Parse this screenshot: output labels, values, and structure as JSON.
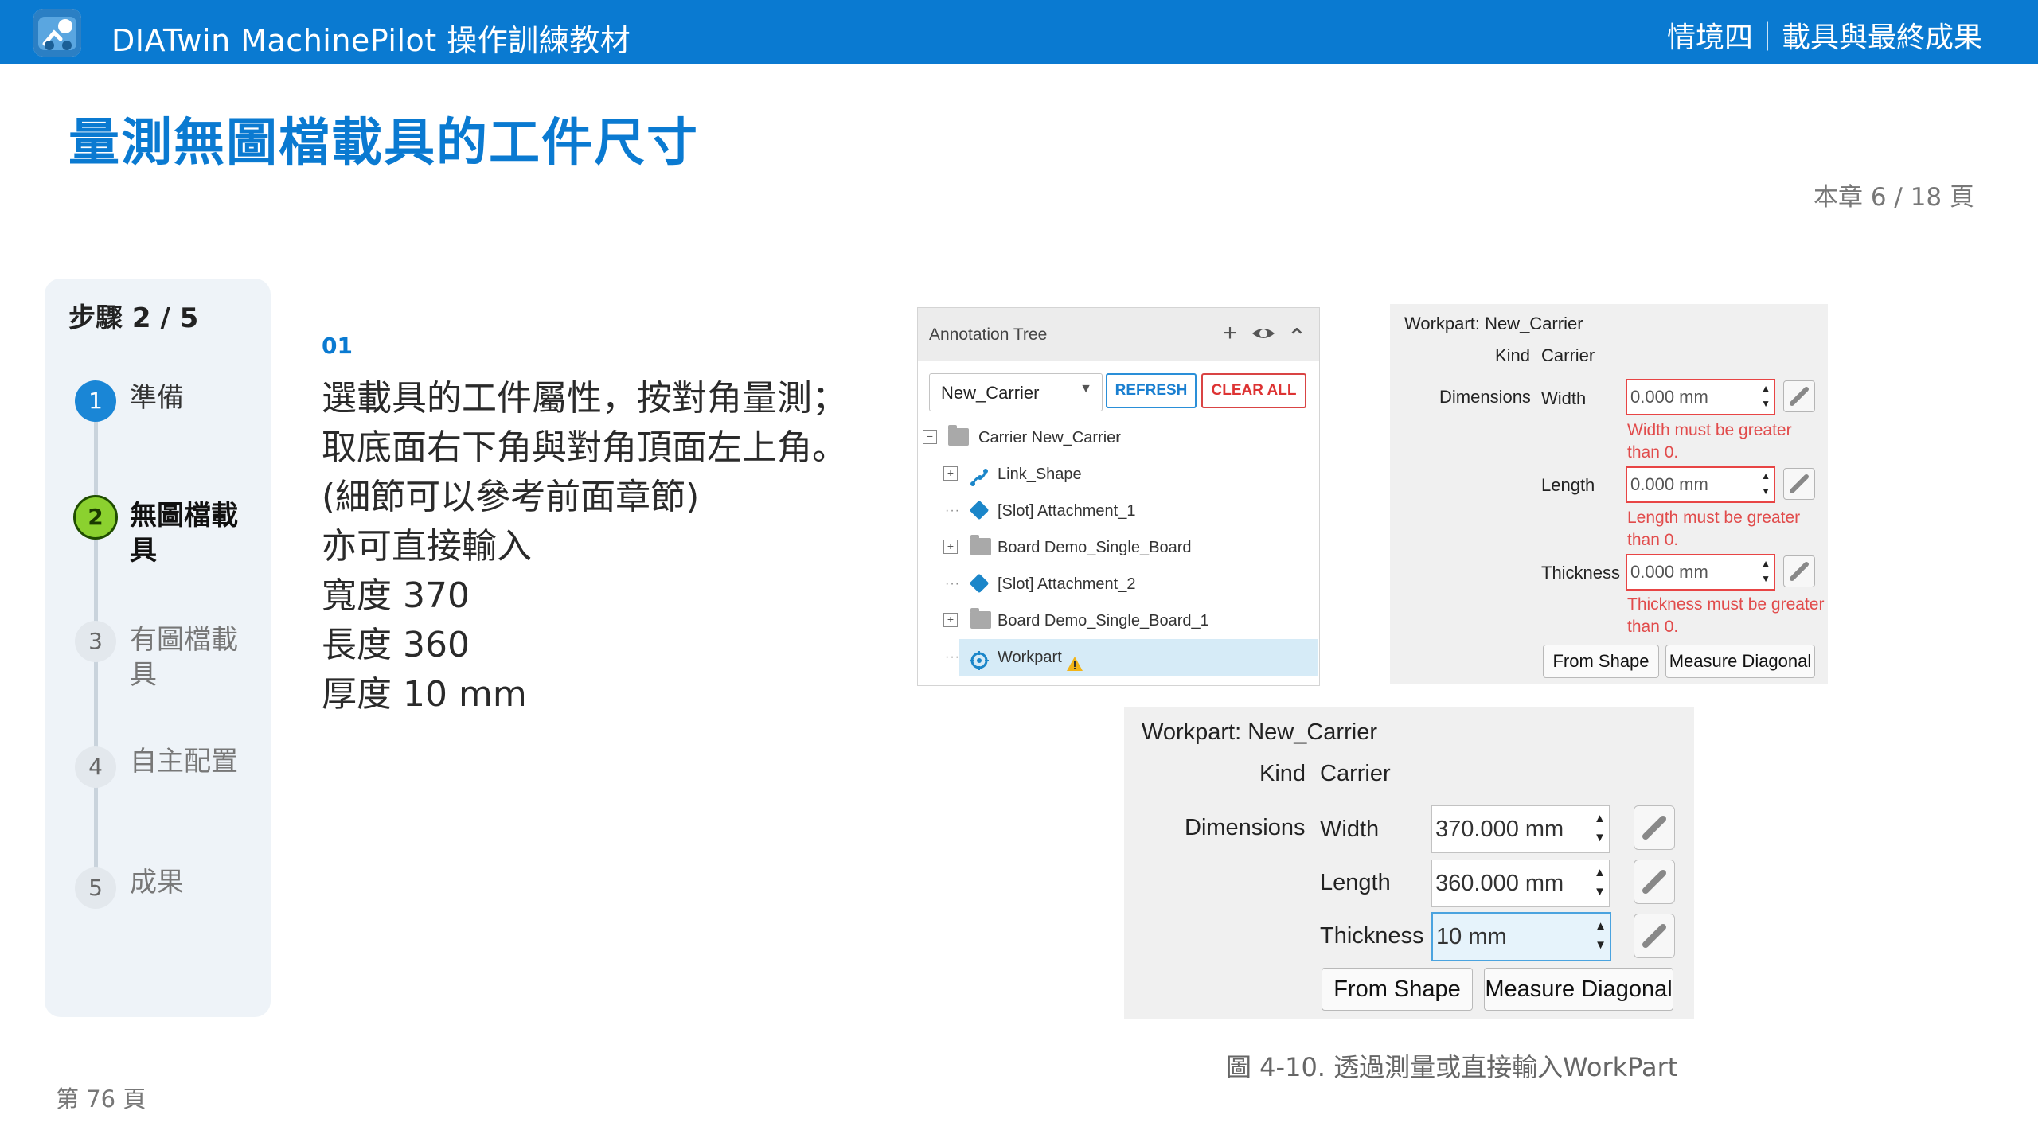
{
  "header": {
    "app_title": "DIATwin MachinePilot 操作訓練教材",
    "chapter_title": "情境四｜載具與最終成果"
  },
  "page": {
    "title": "量測無圖檔載具的工件尺寸",
    "chapter_progress": "本章 6 / 18 頁",
    "page_number": "第 76 頁"
  },
  "steps": {
    "counter": "步驟 2 / 5",
    "items": [
      {
        "num": "1",
        "label": "準備",
        "state": "done"
      },
      {
        "num": "2",
        "label": "無圖檔載具",
        "state": "current"
      },
      {
        "num": "3",
        "label": "有圖檔載具",
        "state": "pending"
      },
      {
        "num": "4",
        "label": "自主配置",
        "state": "pending"
      },
      {
        "num": "5",
        "label": "成果",
        "state": "pending"
      }
    ]
  },
  "instruction": {
    "number": "01",
    "lines": [
      "選載具的工件屬性，按對角量測；",
      "取底面右下角與對角頂面左上角。",
      "(細節可以參考前面章節)",
      "亦可直接輸入",
      "寬度 370",
      "長度 360",
      "厚度 10 mm"
    ]
  },
  "annotation_tree": {
    "title": "Annotation Tree",
    "icons": [
      "plus-icon",
      "eye-icon",
      "chevron-up-icon"
    ],
    "add_glyph": "+",
    "collapse_glyph": "⌃",
    "selected_carrier": "New_Carrier",
    "refresh_label": "REFRESH",
    "clear_all_label": "CLEAR ALL",
    "nodes": [
      {
        "label": "Carrier  New_Carrier",
        "icon": "folder-icon",
        "expander": "⊟"
      },
      {
        "label": "Link_Shape",
        "icon": "link-shape-icon",
        "expander": "⊞"
      },
      {
        "label": "[Slot] Attachment_1",
        "icon": "cube-icon",
        "expander": "···"
      },
      {
        "label": "Board  Demo_Single_Board",
        "icon": "folder-icon",
        "expander": "⊞"
      },
      {
        "label": "[Slot] Attachment_2",
        "icon": "cube-icon",
        "expander": "···"
      },
      {
        "label": "Board  Demo_Single_Board_1",
        "icon": "folder-icon",
        "expander": "⊞"
      },
      {
        "label": "Workpart",
        "icon": "workpart-icon",
        "expander": "···",
        "warning_icon": "warning-icon",
        "selected": true
      }
    ]
  },
  "workpart_before": {
    "title": "Workpart: New_Carrier",
    "kind_label": "Kind",
    "kind_value": "Carrier",
    "dimensions_label": "Dimensions",
    "fields": [
      {
        "label": "Width",
        "value": "0.000 mm",
        "error": "Width must be greater than 0."
      },
      {
        "label": "Length",
        "value": "0.000 mm",
        "error": "Length must be greater than 0."
      },
      {
        "label": "Thickness",
        "value": "0.000 mm",
        "error": "Thickness must be greater than 0."
      }
    ],
    "from_shape_label": "From Shape",
    "measure_diagonal_label": "Measure Diagonal"
  },
  "workpart_after": {
    "title": "Workpart: New_Carrier",
    "kind_label": "Kind",
    "kind_value": "Carrier",
    "dimensions_label": "Dimensions",
    "fields": [
      {
        "label": "Width",
        "value": "370.000 mm"
      },
      {
        "label": "Length",
        "value": "360.000 mm"
      },
      {
        "label": "Thickness",
        "value": "10 mm"
      }
    ],
    "from_shape_label": "From Shape",
    "measure_diagonal_label": "Measure Diagonal"
  },
  "figure_caption": "圖 4-10. 透過測量或直接輸入WorkPart",
  "colors": {
    "brand_blue": "#0a7ad1",
    "step_done": "#1a86d6",
    "step_current": "#8bd12f",
    "error_red": "#e14b4b"
  }
}
